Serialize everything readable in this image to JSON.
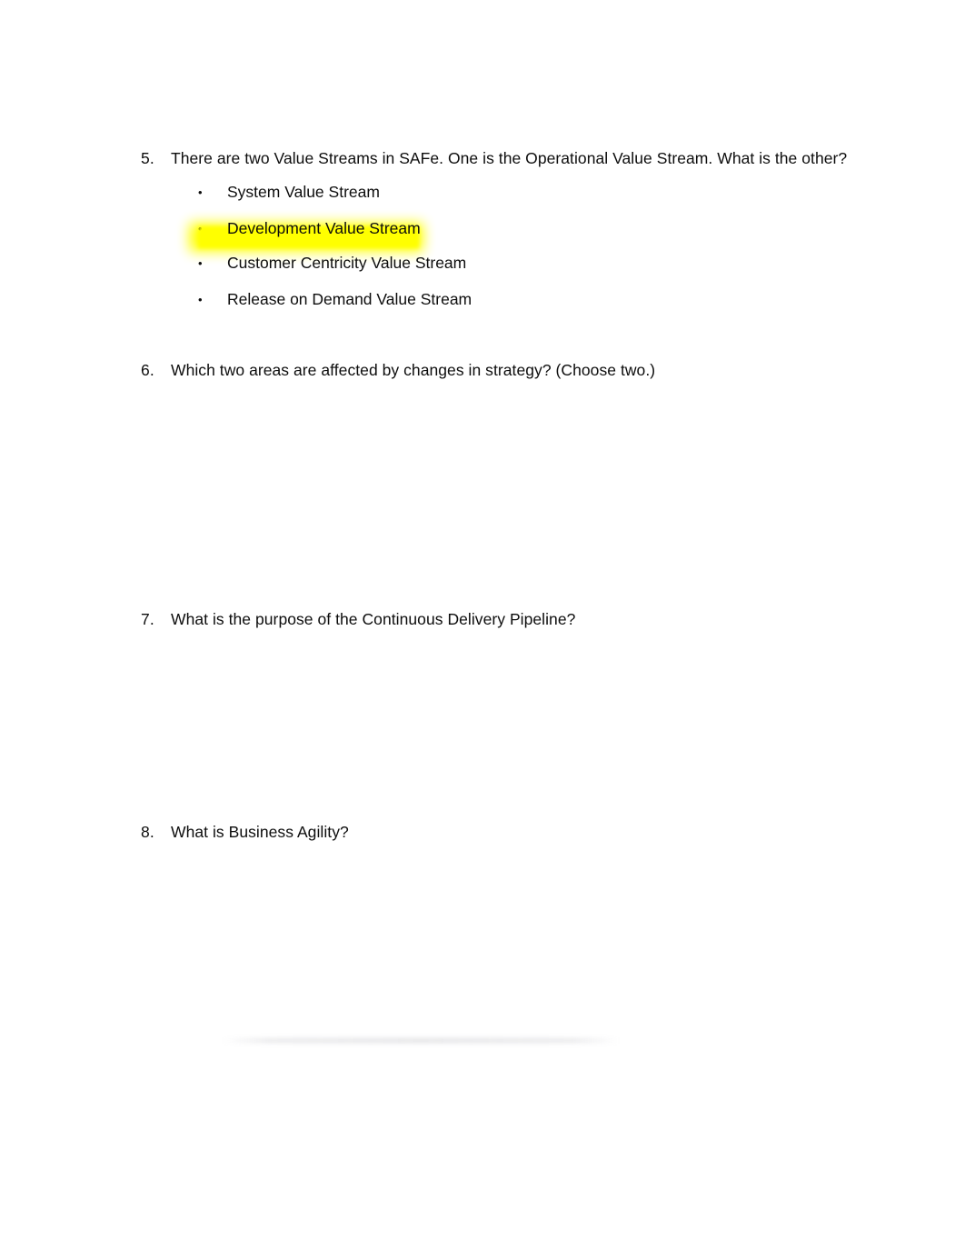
{
  "document": {
    "background_color": "#ffffff",
    "text_color": "#0d0d0d",
    "highlight_color": "#ffff00",
    "bullet_glyph": "•"
  },
  "questions": [
    {
      "number": "5.",
      "text": "There are two Value Streams in SAFe. One is the Operational Value Stream. What is the other?",
      "answers": [
        {
          "label": "System Value Stream",
          "highlighted": false
        },
        {
          "label": "Development Value Stream",
          "highlighted": true
        },
        {
          "label": "Customer Centricity Value Stream",
          "highlighted": false
        },
        {
          "label": "Release on Demand Value Stream",
          "highlighted": false
        }
      ]
    },
    {
      "number": "6.",
      "text": "Which two areas are affected by changes in strategy? (Choose two.)",
      "answers": []
    },
    {
      "number": "7.",
      "text": "What is the purpose of the Continuous Delivery Pipeline?",
      "answers": []
    },
    {
      "number": "8.",
      "text": "What is Business Agility?",
      "answers": []
    }
  ]
}
